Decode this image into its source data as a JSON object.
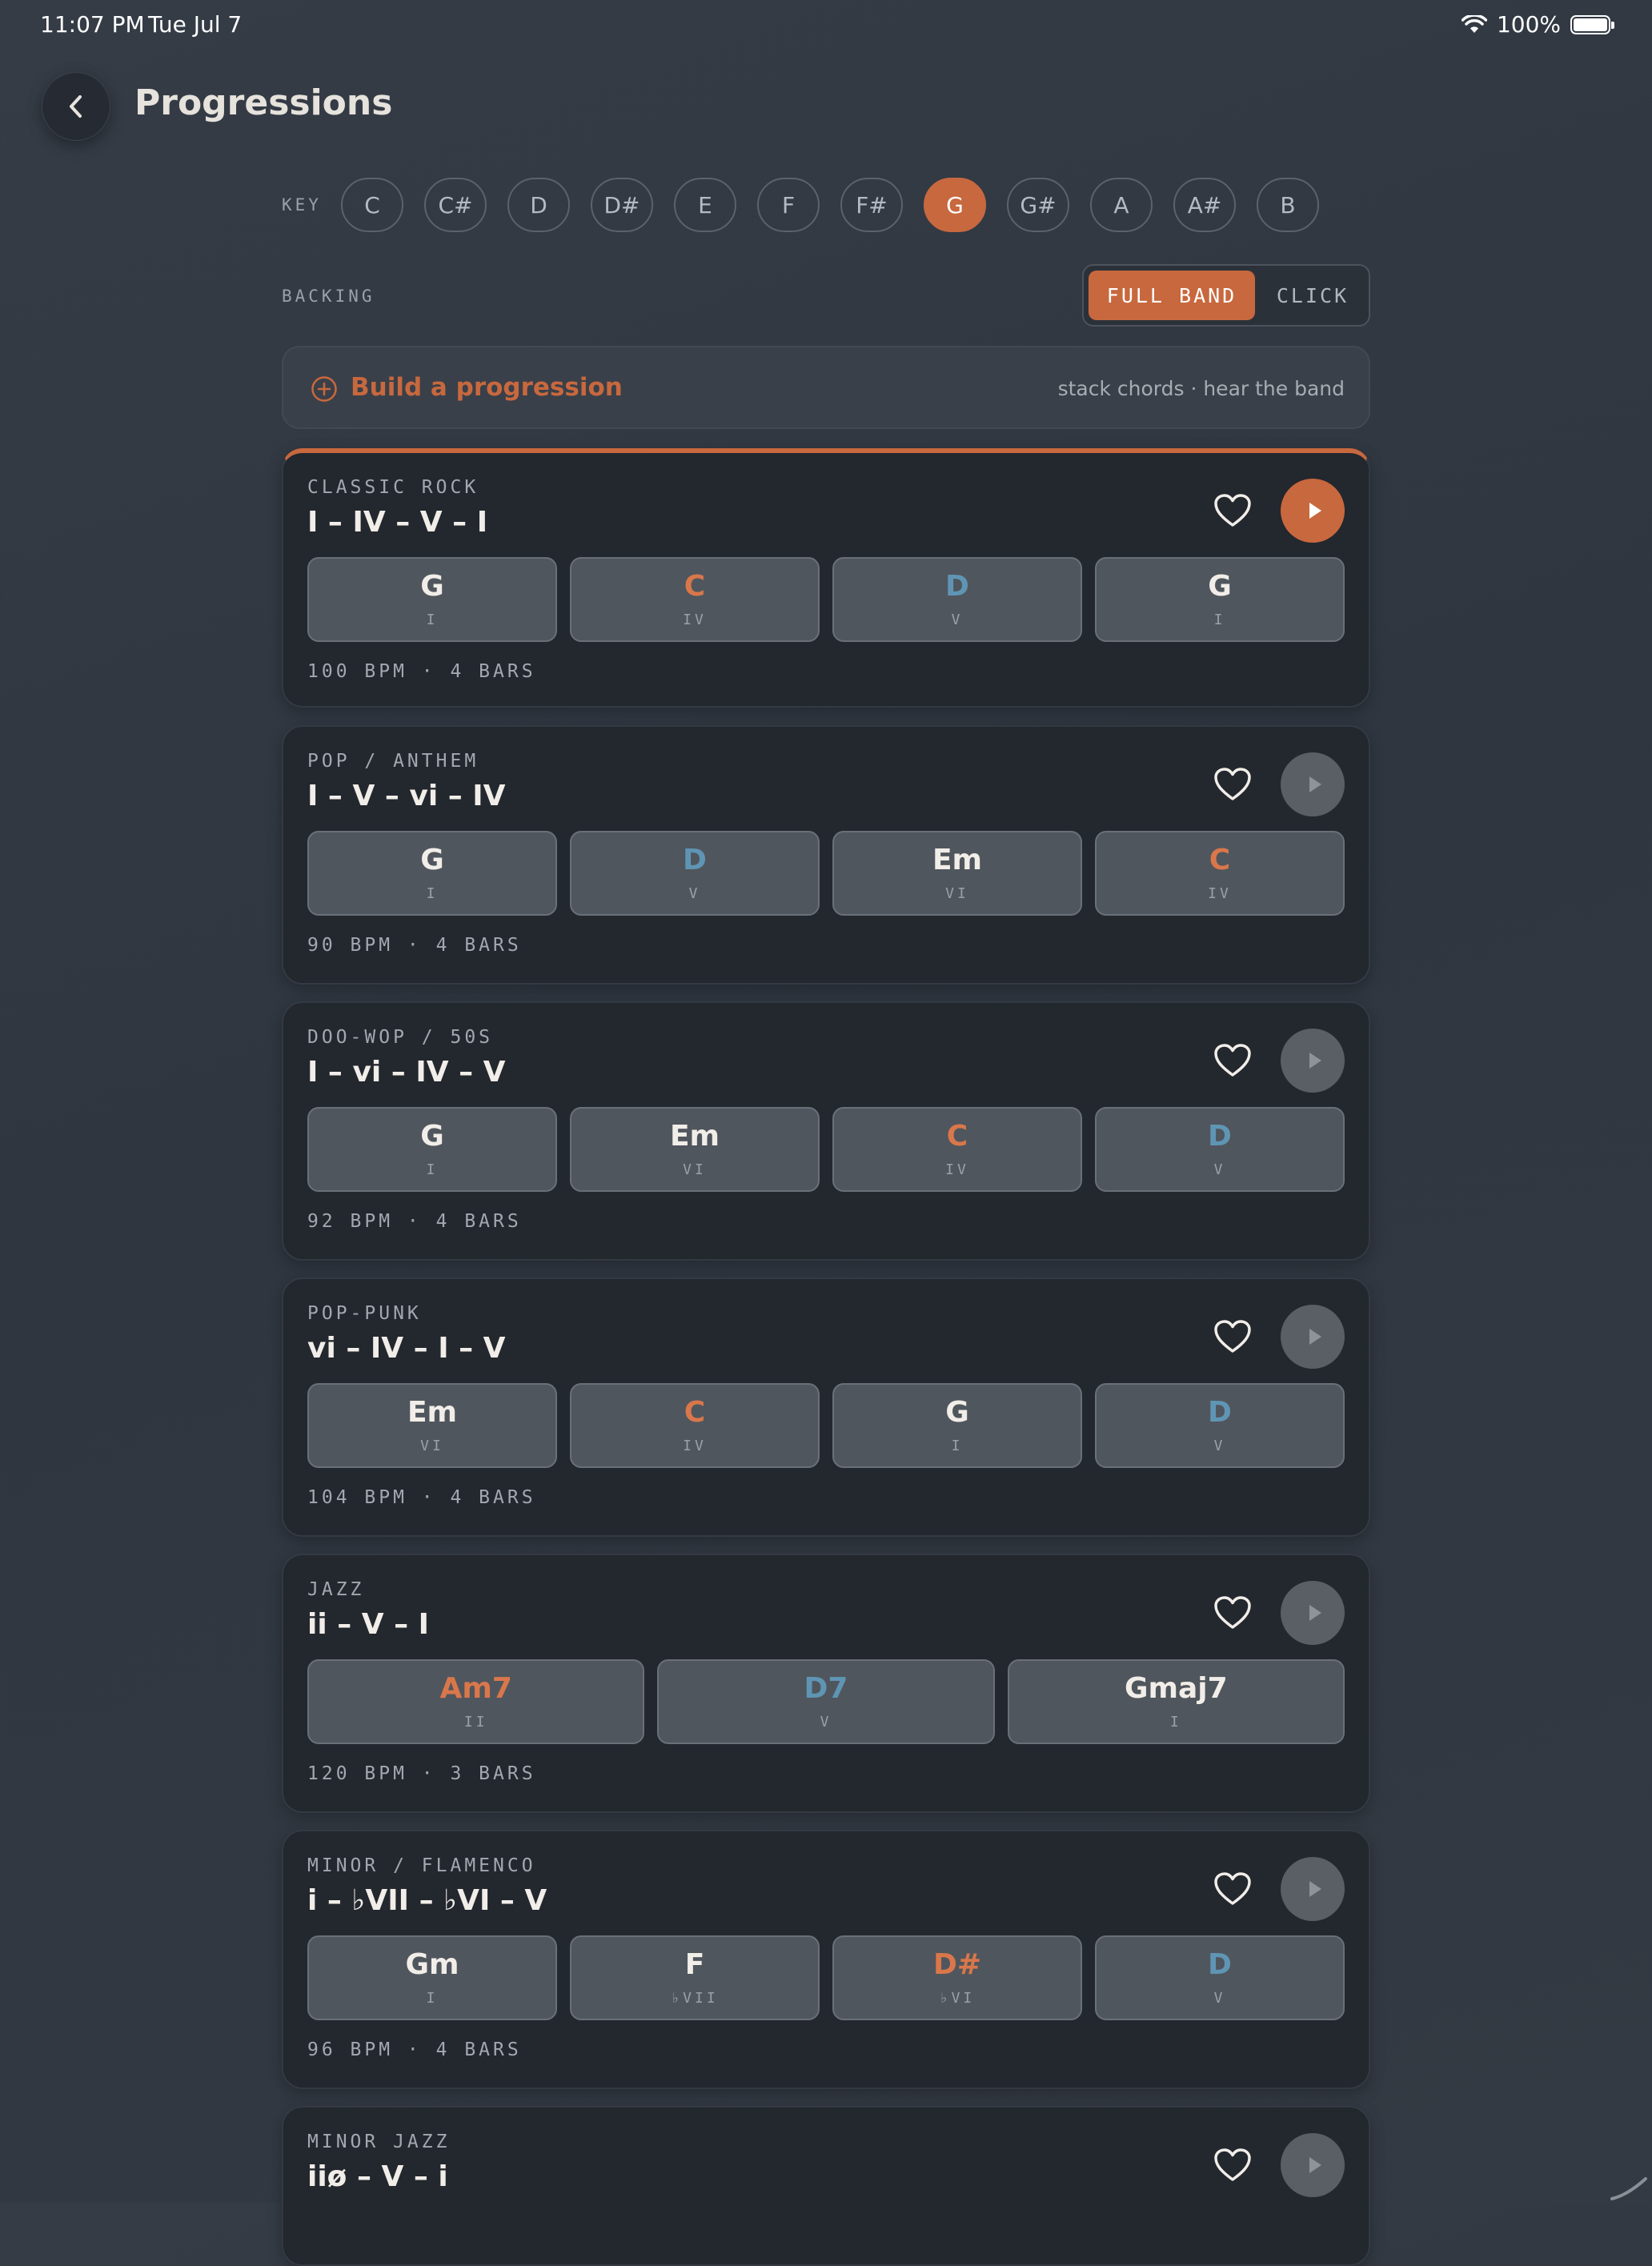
{
  "status": {
    "time": "11:07 PM",
    "date": "Tue Jul 7",
    "battery": "100%"
  },
  "header": {
    "title": "Progressions"
  },
  "key_selector": {
    "label": "KEY",
    "keys": [
      "C",
      "C#",
      "D",
      "D#",
      "E",
      "F",
      "F#",
      "G",
      "G#",
      "A",
      "A#",
      "B"
    ],
    "selected": "G"
  },
  "backing": {
    "label": "BACKING",
    "options": [
      "FULL BAND",
      "CLICK"
    ],
    "selected": "FULL BAND"
  },
  "builder": {
    "label": "Build a progression",
    "hint": "stack chords · hear the band"
  },
  "colors": {
    "accent": "#c8683e",
    "chord_tonic": "#f1ede8",
    "chord_subdominant": "#d9774b",
    "chord_dominant": "#5f95b4"
  },
  "cards": [
    {
      "genre": "CLASSIC ROCK",
      "numerals": "I – IV – V – I",
      "meta": "100 BPM · 4 BARS",
      "playing": true,
      "chords": [
        {
          "name": "G",
          "degree": "I",
          "tone": "white"
        },
        {
          "name": "C",
          "degree": "IV",
          "tone": "orange"
        },
        {
          "name": "D",
          "degree": "V",
          "tone": "blue"
        },
        {
          "name": "G",
          "degree": "I",
          "tone": "white"
        }
      ]
    },
    {
      "genre": "POP / ANTHEM",
      "numerals": "I – V – vi – IV",
      "meta": "90 BPM · 4 BARS",
      "playing": false,
      "chords": [
        {
          "name": "G",
          "degree": "I",
          "tone": "white"
        },
        {
          "name": "D",
          "degree": "V",
          "tone": "blue"
        },
        {
          "name": "Em",
          "degree": "VI",
          "tone": "white"
        },
        {
          "name": "C",
          "degree": "IV",
          "tone": "orange"
        }
      ]
    },
    {
      "genre": "DOO-WOP / 50S",
      "numerals": "I – vi – IV – V",
      "meta": "92 BPM · 4 BARS",
      "playing": false,
      "chords": [
        {
          "name": "G",
          "degree": "I",
          "tone": "white"
        },
        {
          "name": "Em",
          "degree": "VI",
          "tone": "white"
        },
        {
          "name": "C",
          "degree": "IV",
          "tone": "orange"
        },
        {
          "name": "D",
          "degree": "V",
          "tone": "blue"
        }
      ]
    },
    {
      "genre": "POP-PUNK",
      "numerals": "vi – IV – I – V",
      "meta": "104 BPM · 4 BARS",
      "playing": false,
      "chords": [
        {
          "name": "Em",
          "degree": "VI",
          "tone": "white"
        },
        {
          "name": "C",
          "degree": "IV",
          "tone": "orange"
        },
        {
          "name": "G",
          "degree": "I",
          "tone": "white"
        },
        {
          "name": "D",
          "degree": "V",
          "tone": "blue"
        }
      ]
    },
    {
      "genre": "JAZZ",
      "numerals": "ii – V – I",
      "meta": "120 BPM · 3 BARS",
      "playing": false,
      "chords": [
        {
          "name": "Am7",
          "degree": "II",
          "tone": "orange"
        },
        {
          "name": "D7",
          "degree": "V",
          "tone": "blue"
        },
        {
          "name": "Gmaj7",
          "degree": "I",
          "tone": "white"
        }
      ]
    },
    {
      "genre": "MINOR / FLAMENCO",
      "numerals": "i – ♭VII – ♭VI – V",
      "meta": "96 BPM · 4 BARS",
      "playing": false,
      "chords": [
        {
          "name": "Gm",
          "degree": "I",
          "tone": "white"
        },
        {
          "name": "F",
          "degree": "♭VII",
          "tone": "white"
        },
        {
          "name": "D#",
          "degree": "♭VI",
          "tone": "orange"
        },
        {
          "name": "D",
          "degree": "V",
          "tone": "blue"
        }
      ]
    },
    {
      "genre": "MINOR JAZZ",
      "numerals": "iiø – V – i",
      "meta": "",
      "playing": false,
      "chords": []
    }
  ]
}
